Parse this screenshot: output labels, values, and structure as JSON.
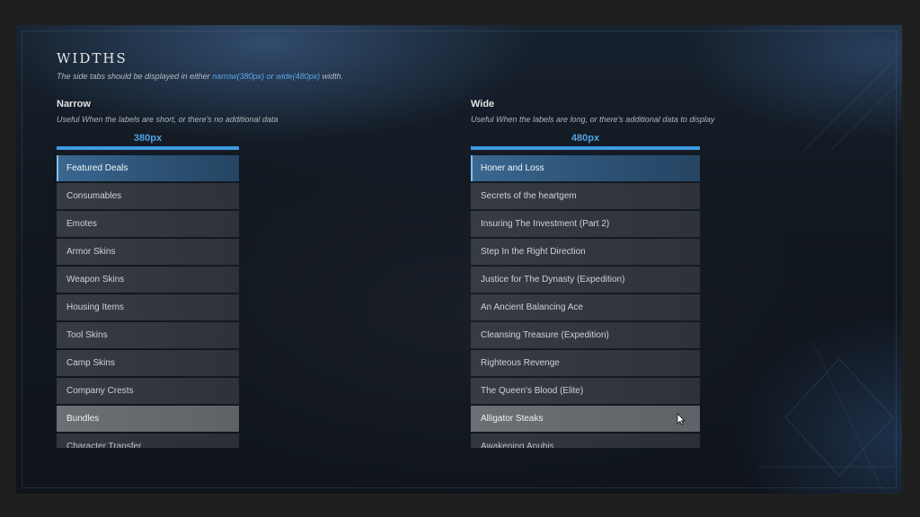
{
  "header": {
    "title": "WIDTHS",
    "subtitle_pre": "The side tabs should be displayed in either ",
    "subtitle_highlight": "narrow(380px) or wide(480px)",
    "subtitle_post": " width."
  },
  "narrow": {
    "heading": "Narrow",
    "description": "Useful When the labels are short, or there's no additional data",
    "width_label": "380px",
    "selected_index": 0,
    "hover_index": 9,
    "items": [
      {
        "label": "Featured Deals"
      },
      {
        "label": "Consumables"
      },
      {
        "label": "Emotes"
      },
      {
        "label": "Armor Skins"
      },
      {
        "label": "Weapon Skins"
      },
      {
        "label": "Housing Items"
      },
      {
        "label": "Tool Skins"
      },
      {
        "label": "Camp Skins"
      },
      {
        "label": "Company Crests"
      },
      {
        "label": "Bundles"
      },
      {
        "label": "Character Transfer"
      }
    ]
  },
  "wide": {
    "heading": "Wide",
    "description": "Useful When the labels are long, or  there's additional data to display",
    "width_label": "480px",
    "selected_index": 0,
    "hover_index": 9,
    "items": [
      {
        "label": "Honer and Loss"
      },
      {
        "label": "Secrets of the heartgem"
      },
      {
        "label": "Insuring The Investment (Part 2)"
      },
      {
        "label": "Step In the Right Direction"
      },
      {
        "label": "Justice for The Dynasty (Expedition)"
      },
      {
        "label": "An Ancient Balancing Ace"
      },
      {
        "label": " Cleansing Treasure (Expedition)"
      },
      {
        "label": "Righteous Revenge"
      },
      {
        "label": "The Queen's Blood (Elite)"
      },
      {
        "label": "Alligator Steaks"
      },
      {
        "label": "Awakening Anubis"
      }
    ]
  },
  "colors": {
    "accent": "#3f9be0",
    "selected_tab": "#2c5275",
    "hover_tab": "#66696e"
  },
  "icons": {
    "cursor": "mouse-pointer-icon"
  }
}
